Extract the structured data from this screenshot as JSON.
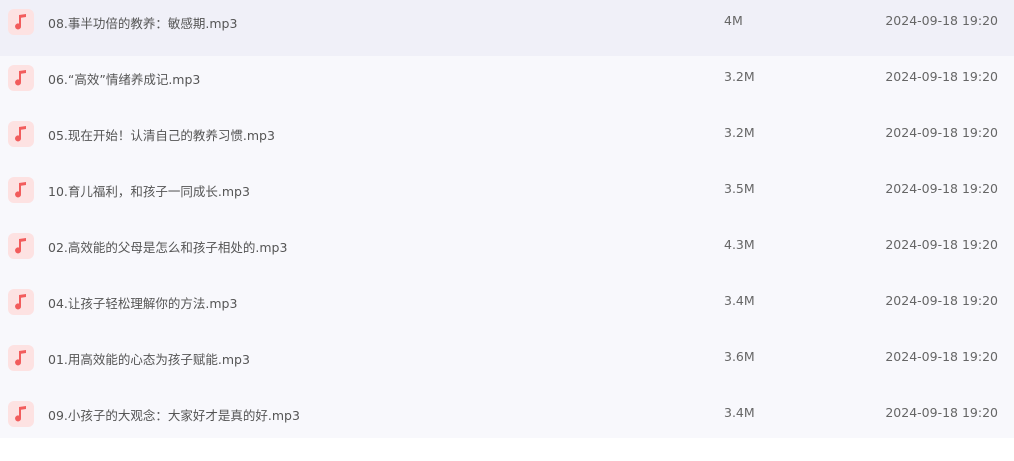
{
  "icon_color": "#f25c5c",
  "icon_bg": "#fde2e2",
  "files": [
    {
      "icon": "music-note-icon",
      "name": "08.事半功倍的教养：敏感期.mp3",
      "size": "4M",
      "date": "2024-09-18 19:20"
    },
    {
      "icon": "music-note-icon",
      "name": "06.“高效”情绪养成记.mp3",
      "size": "3.2M",
      "date": "2024-09-18 19:20"
    },
    {
      "icon": "music-note-icon",
      "name": "05.现在开始！认清自己的教养习惯.mp3",
      "size": "3.2M",
      "date": "2024-09-18 19:20"
    },
    {
      "icon": "music-note-icon",
      "name": "10.育儿福利，和孩子一同成长.mp3",
      "size": "3.5M",
      "date": "2024-09-18 19:20"
    },
    {
      "icon": "music-note-icon",
      "name": "02.高效能的父母是怎么和孩子相处的.mp3",
      "size": "4.3M",
      "date": "2024-09-18 19:20"
    },
    {
      "icon": "music-note-icon",
      "name": "04.让孩子轻松理解你的方法.mp3",
      "size": "3.4M",
      "date": "2024-09-18 19:20"
    },
    {
      "icon": "music-note-icon",
      "name": "01.用高效能的心态为孩子赋能.mp3",
      "size": "3.6M",
      "date": "2024-09-18 19:20"
    },
    {
      "icon": "music-note-icon",
      "name": "09.小孩子的大观念：大家好才是真的好.mp3",
      "size": "3.4M",
      "date": "2024-09-18 19:20"
    }
  ]
}
